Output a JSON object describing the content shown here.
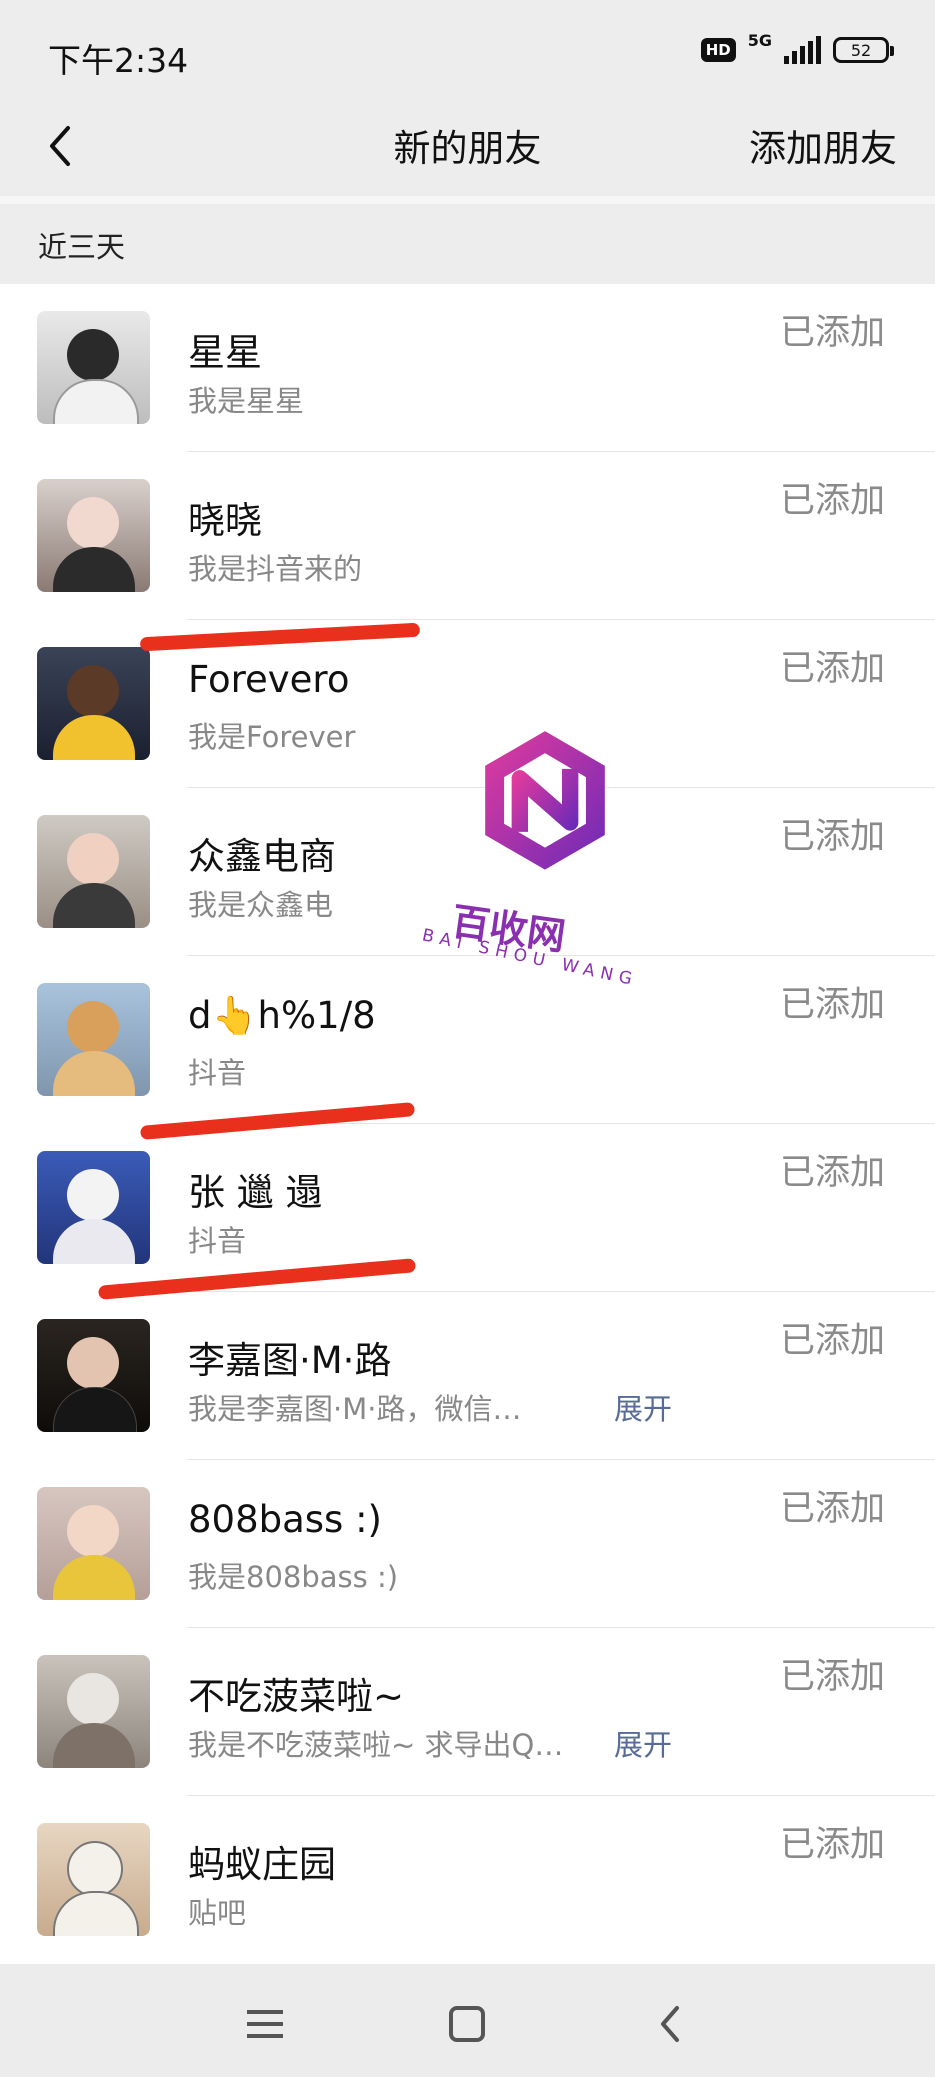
{
  "status_bar": {
    "time": "下午2:34",
    "hd": "HD",
    "network": "5G",
    "battery": "52"
  },
  "nav": {
    "title": "新的朋友",
    "action": "添加朋友"
  },
  "section": {
    "title": "近三天"
  },
  "colors": {
    "accent_link": "#576b95",
    "annotation_red": "#e8301c",
    "background": "#ededed"
  },
  "friends": [
    {
      "name": "星星",
      "message": "我是星星",
      "status": "已添加"
    },
    {
      "name": "晓晓",
      "message": "我是抖音来的",
      "status": "已添加"
    },
    {
      "name": "Forevero",
      "message": "我是Forever",
      "status": "已添加"
    },
    {
      "name": "众鑫电商",
      "message": "我是众鑫电",
      "status": "已添加"
    },
    {
      "name": "d👆h%1/8",
      "message": "抖音",
      "status": "已添加"
    },
    {
      "name": "张 邋 遢",
      "message": "抖音",
      "status": "已添加"
    },
    {
      "name": "李嘉图·M·路",
      "message": "我是李嘉图·M·路，微信…",
      "expand": "展开",
      "status": "已添加"
    },
    {
      "name": "808bass :)",
      "message": "我是808bass :)",
      "status": "已添加"
    },
    {
      "name": "不吃菠菜啦~",
      "message": "我是不吃菠菜啦~ 求导出Q…",
      "expand": "展开",
      "status": "已添加"
    },
    {
      "name": "蚂蚁庄园",
      "message": "贴吧",
      "status": "已添加"
    }
  ],
  "watermark": {
    "title": "百收网",
    "subtitle": "BAI SHOU WANG"
  },
  "bottom_nav": {
    "menu_icon": "menu-icon",
    "home_icon": "home-icon",
    "back_icon": "back-icon"
  }
}
